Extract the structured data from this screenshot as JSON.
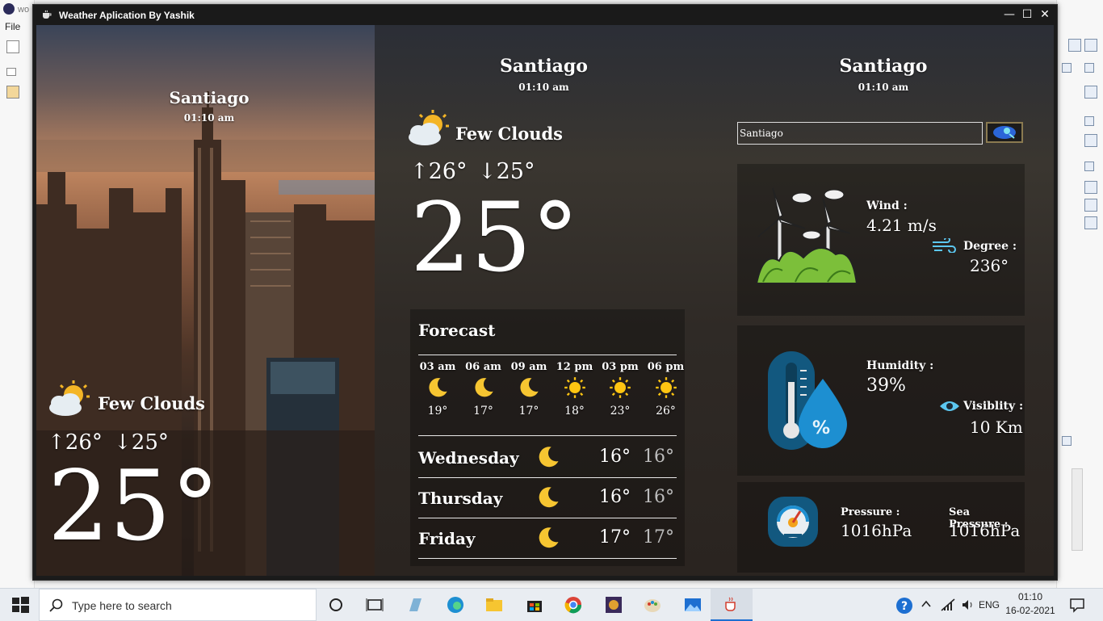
{
  "ide": {
    "tab_title": "wo",
    "menu_file": "File"
  },
  "window": {
    "title": "Weather Aplication By Yashik",
    "min": "—",
    "max": "☐",
    "close": "✕"
  },
  "left": {
    "city": "Santiago",
    "time": "01:10 am",
    "condition": "Few Clouds",
    "high": "↑26°",
    "low": "↓25°",
    "temp": "25°"
  },
  "middle": {
    "city": "Santiago",
    "time": "01:10 am",
    "condition": "Few Clouds",
    "high": "↑26°",
    "low": "↓25°",
    "temp": "25°",
    "forecast_title": "Forecast",
    "hourly": [
      {
        "time": "03 am",
        "icon": "moon-icon",
        "temp": "19°"
      },
      {
        "time": "06 am",
        "icon": "moon-icon",
        "temp": "17°"
      },
      {
        "time": "09 am",
        "icon": "moon-icon",
        "temp": "17°"
      },
      {
        "time": "12 pm",
        "icon": "sun-icon",
        "temp": "18°"
      },
      {
        "time": "03 pm",
        "icon": "sun-icon",
        "temp": "23°"
      },
      {
        "time": "06 pm",
        "icon": "sun-icon",
        "temp": "26°"
      }
    ],
    "daily": [
      {
        "day": "Wednesday",
        "icon": "moon-icon",
        "max": "16°",
        "min": "16°"
      },
      {
        "day": "Thursday",
        "icon": "moon-icon",
        "max": "16°",
        "min": "16°"
      },
      {
        "day": "Friday",
        "icon": "moon-icon",
        "max": "17°",
        "min": "17°"
      }
    ]
  },
  "right": {
    "city": "Santiago",
    "time": "01:10 am",
    "search_value": "Santiago",
    "wind_label": "Wind :",
    "wind_value": "4.21 m/s",
    "degree_label": "Degree :",
    "degree_value": "236°",
    "humidity_label": "Humidity :",
    "humidity_value": "39%",
    "visibility_label": "Visiblity :",
    "visibility_value": "10 Km",
    "pressure_label": "Pressure :",
    "pressure_value": "1016hPa",
    "sea_pressure_label": "Sea Pressure :",
    "sea_pressure_value": "1016hPa"
  },
  "taskbar": {
    "search_placeholder": "Type here to search",
    "language": "ENG",
    "time": "01:10",
    "date": "16-02-2021"
  },
  "colors": {
    "moon": "#f6c531",
    "sun": "#ffc512",
    "accent_blue": "#1a82c4"
  }
}
